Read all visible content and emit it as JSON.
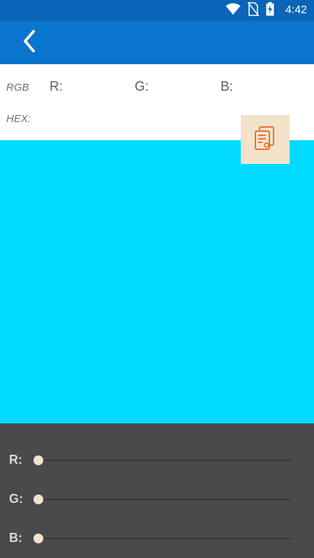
{
  "status_bar": {
    "time": "4:42",
    "icons": [
      "wifi-icon",
      "no-sim-icon",
      "battery-charging-icon"
    ]
  },
  "app_bar": {
    "back_icon": "chevron-left-icon",
    "color": "#0a75cc"
  },
  "info": {
    "rgb_label": "RGB",
    "r_label": "R:",
    "g_label": "G:",
    "b_label": "B:",
    "hex_label": "HEX:",
    "copy_icon": "copy-document-icon"
  },
  "preview": {
    "color": "#00dcff"
  },
  "sliders": [
    {
      "label": "R:",
      "value": 0
    },
    {
      "label": "G:",
      "value": 0
    },
    {
      "label": "B:",
      "value": 0
    }
  ],
  "colors": {
    "accent": "#f3e3cb",
    "icon_orange": "#e8712f",
    "panel_bg": "#4a4a4c"
  }
}
